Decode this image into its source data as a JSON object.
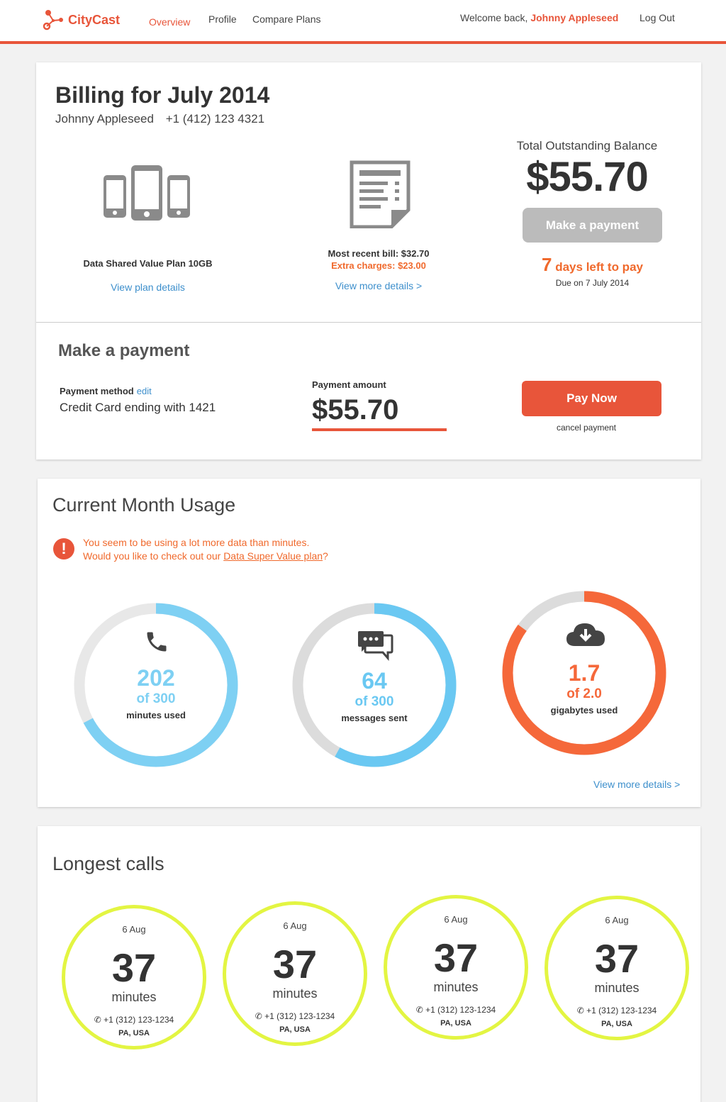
{
  "header": {
    "brand": "CityCast",
    "nav": [
      "Overview",
      "Profile",
      "Compare Plans"
    ],
    "welcome_prefix": "Welcome back,",
    "user_name": "Johnny Appleseed",
    "logout": "Log Out"
  },
  "billing": {
    "title": "Billing for July 2014",
    "customer_name": "Johnny Appleseed",
    "phone": "+1 (412) 123 4321",
    "plan_name": "Data Shared Value Plan 10GB",
    "plan_link": "View plan details",
    "recent_bill": "Most recent bill: $32.70",
    "extra_charges": "Extra charges: $23.00",
    "bill_link": "View more details >",
    "balance_label": "Total Outstanding Balance",
    "balance_amount": "$55.70",
    "make_payment_button": "Make a payment",
    "days_left_number": "7",
    "days_left_text": "days left to pay",
    "due_date": "Due on 7 July 2014"
  },
  "payment": {
    "title": "Make a payment",
    "method_label": "Payment method",
    "method_edit": "edit",
    "method_value": "Credit Card ending with 1421",
    "amount_label": "Payment amount",
    "amount_value": "$55.70",
    "pay_button": "Pay Now",
    "cancel": "cancel payment"
  },
  "usage": {
    "title": "Current Month Usage",
    "alert_line1": "You seem to be using a lot more data than minutes.",
    "alert_line2_prefix": "Would you like to check out our ",
    "alert_plan_link": "Data Super Value plan",
    "alert_line2_suffix": "?",
    "gauges": [
      {
        "icon": "phone-icon",
        "value": "202",
        "of": "of 300",
        "unit": "minutes used",
        "fraction": 0.673,
        "color": "#7ed0f3"
      },
      {
        "icon": "chat-icon",
        "value": "64",
        "of": "of 300",
        "unit": "messages sent",
        "fraction": 0.58,
        "color": "#6ac8f2"
      },
      {
        "icon": "cloud-download-icon",
        "value": "1.7",
        "of": "of 2.0",
        "unit": "gigabytes used",
        "fraction": 0.85,
        "color": "#f5683a"
      }
    ],
    "details_link": "View more details >"
  },
  "calls": {
    "title": "Longest calls",
    "items": [
      {
        "date": "6 Aug",
        "number": "37",
        "unit": "minutes",
        "phone": "+1 (312) 123-1234",
        "location": "PA, USA"
      },
      {
        "date": "6 Aug",
        "number": "37",
        "unit": "minutes",
        "phone": "+1 (312) 123-1234",
        "location": "PA, USA"
      },
      {
        "date": "6 Aug",
        "number": "37",
        "unit": "minutes",
        "phone": "+1 (312) 123-1234",
        "location": "PA, USA"
      },
      {
        "date": "6 Aug",
        "number": "37",
        "unit": "minutes",
        "phone": "+1 (312) 123-1234",
        "location": "PA, USA"
      }
    ]
  },
  "colors": {
    "accent": "#e8553a",
    "orange": "#f0692c",
    "link": "#3d8fcc",
    "call_ring": "#e3f542"
  }
}
